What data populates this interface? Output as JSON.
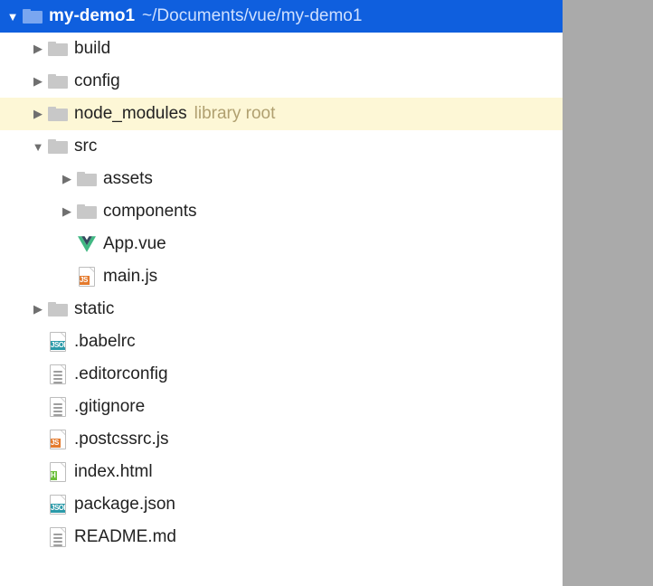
{
  "root": {
    "name": "my-demo1",
    "path": "~/Documents/vue/my-demo1"
  },
  "nodes": [
    {
      "id": "build",
      "depth": 1,
      "kind": "folder",
      "arrow": "right",
      "label": "build"
    },
    {
      "id": "config",
      "depth": 1,
      "kind": "folder",
      "arrow": "right",
      "label": "config"
    },
    {
      "id": "node_modules",
      "depth": 1,
      "kind": "folder",
      "arrow": "right",
      "label": "node_modules",
      "annot": "library root",
      "libroot": true
    },
    {
      "id": "src",
      "depth": 1,
      "kind": "folder",
      "arrow": "down",
      "label": "src"
    },
    {
      "id": "assets",
      "depth": 2,
      "kind": "folder",
      "arrow": "right",
      "label": "assets"
    },
    {
      "id": "components",
      "depth": 2,
      "kind": "folder",
      "arrow": "right",
      "label": "components"
    },
    {
      "id": "app-vue",
      "depth": 2,
      "kind": "vue",
      "arrow": "none",
      "label": "App.vue"
    },
    {
      "id": "main-js",
      "depth": 2,
      "kind": "js",
      "arrow": "none",
      "label": "main.js"
    },
    {
      "id": "static",
      "depth": 1,
      "kind": "folder",
      "arrow": "right",
      "label": "static"
    },
    {
      "id": "babelrc",
      "depth": 1,
      "kind": "json",
      "arrow": "none",
      "label": ".babelrc"
    },
    {
      "id": "editorconfig",
      "depth": 1,
      "kind": "text",
      "arrow": "none",
      "label": ".editorconfig"
    },
    {
      "id": "gitignore",
      "depth": 1,
      "kind": "text",
      "arrow": "none",
      "label": ".gitignore"
    },
    {
      "id": "postcssrc",
      "depth": 1,
      "kind": "js",
      "arrow": "none",
      "label": ".postcssrc.js"
    },
    {
      "id": "index-html",
      "depth": 1,
      "kind": "html",
      "arrow": "none",
      "label": "index.html"
    },
    {
      "id": "package-json",
      "depth": 1,
      "kind": "json",
      "arrow": "none",
      "label": "package.json"
    },
    {
      "id": "readme",
      "depth": 1,
      "kind": "text",
      "arrow": "none",
      "label": "README.md"
    }
  ]
}
